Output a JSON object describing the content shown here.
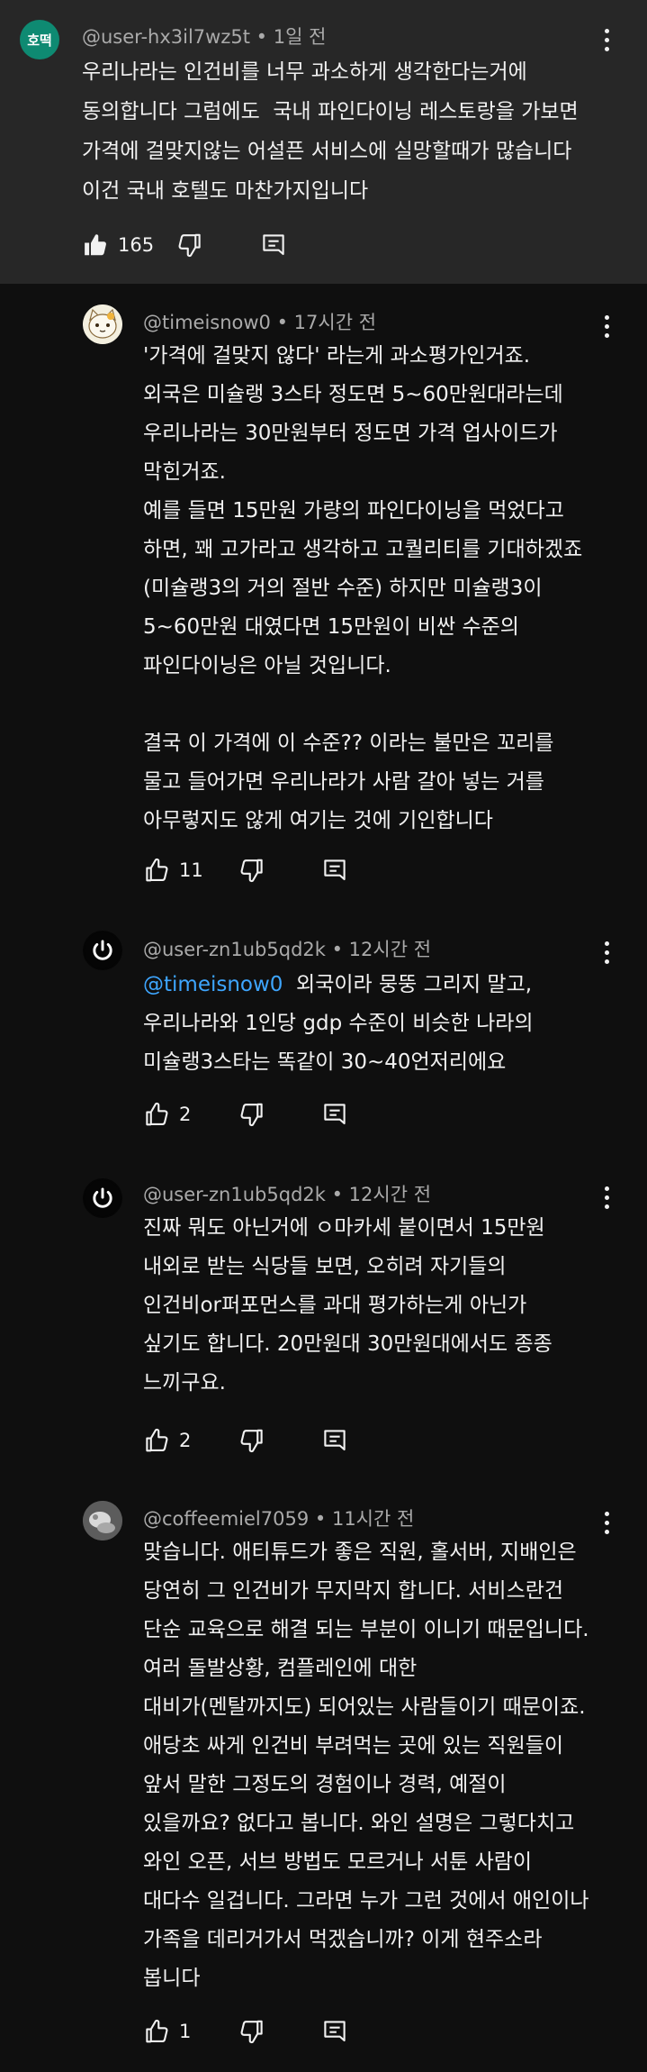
{
  "parent": {
    "avatar_text": "호떡",
    "author": "@user-hx3il7wz5t",
    "time": "1일 전",
    "text": "우리나라는 인건비를 너무 과소하게 생각한다는거에\n동의합니다 그럼에도  국내 파인다이닝 레스토랑을 가보면\n가격에 걸맞지않는 어설픈 서비스에 실망할때가 많습니다\n이건 국내 호텔도 마찬가지입니다",
    "likes": "165",
    "colors": {
      "bg": "#272727",
      "avatar": "#0e8a72"
    }
  },
  "replies": [
    {
      "author": "@timeisnow0",
      "time": "17시간 전",
      "mention": "",
      "text": "'가격에 걸맞지 않다' 라는게 과소평가인거죠.\n외국은 미슐랭 3스타 정도면 5~60만원대라는데\n우리나라는 30만원부터 정도면 가격 업사이드가\n막힌거죠.\n예를 들면 15만원 가량의 파인다이닝을 먹었다고\n하면, 꽤 고가라고 생각하고 고퀄리티를 기대하겠죠\n(미슐랭3의 거의 절반 수준) 하지만 미슐랭3이\n5~60만원 대였다면 15만원이 비싼 수준의\n파인다이닝은 아닐 것입니다.\n\n결국 이 가격에 이 수준?? 이라는 불만은 꼬리를\n물고 들어가면 우리나라가 사람 갈아 넣는 거를\n아무렇지도 않게 여기는 것에 기인합니다",
      "likes": "11",
      "avatar_icon": "cat-avatar"
    },
    {
      "author": "@user-zn1ub5qd2k",
      "time": "12시간 전",
      "mention": "@timeisnow0",
      "text": "  외국이라 뭉뚱 그리지 말고,\n우리나라와 1인당 gdp 수준이 비슷한 나라의\n미슐랭3스타는 똑같이 30~40언저리에요",
      "likes": "2",
      "avatar_icon": "power-avatar"
    },
    {
      "author": "@user-zn1ub5qd2k",
      "time": "12시간 전",
      "mention": "",
      "text": "진짜 뭐도 아닌거에 ㅇ마카세 붙이면서 15만원\n내외로 받는 식당들 보면, 오히려 자기들의\n인건비or퍼포먼스를 과대 평가하는게 아닌가\n싶기도 합니다. 20만원대 30만원대에서도 종종\n느끼구요.",
      "likes": "2",
      "avatar_icon": "power-avatar"
    },
    {
      "author": "@coffeemiel7059",
      "time": "11시간 전",
      "mention": "",
      "text": "맞습니다. 애티튜드가 좋은 직원, 홀서버, 지배인은\n당연히 그 인건비가 무지막지 합니다. 서비스란건\n단순 교육으로 해결 되는 부분이 이니기 때문입니다.\n여러 돌발상황, 컴플레인에 대한\n대비가(멘탈까지도) 되어있는 사람들이기 때문이죠.\n애당초 싸게 인건비 부려먹는 곳에 있는 직원들이\n앞서 말한 그정도의 경험이나 경력, 예절이\n있을까요? 없다고 봅니다. 와인 설명은 그렇다치고\n와인 오픈, 서브 방법도 모르거나 서툰 사람이\n대다수 일겁니다. 그라면 누가 그런 것에서 애인이나\n가족을 데리거가서 먹겠습니까? 이게 현주소라\n봅니다",
      "likes": "1",
      "avatar_icon": "photo-avatar"
    }
  ],
  "separator": " • ",
  "colors": {
    "page_bg": "#0f0f0f",
    "text": "#f1f1f1",
    "meta": "#aaaaaa",
    "mention": "#3ea6ff"
  }
}
